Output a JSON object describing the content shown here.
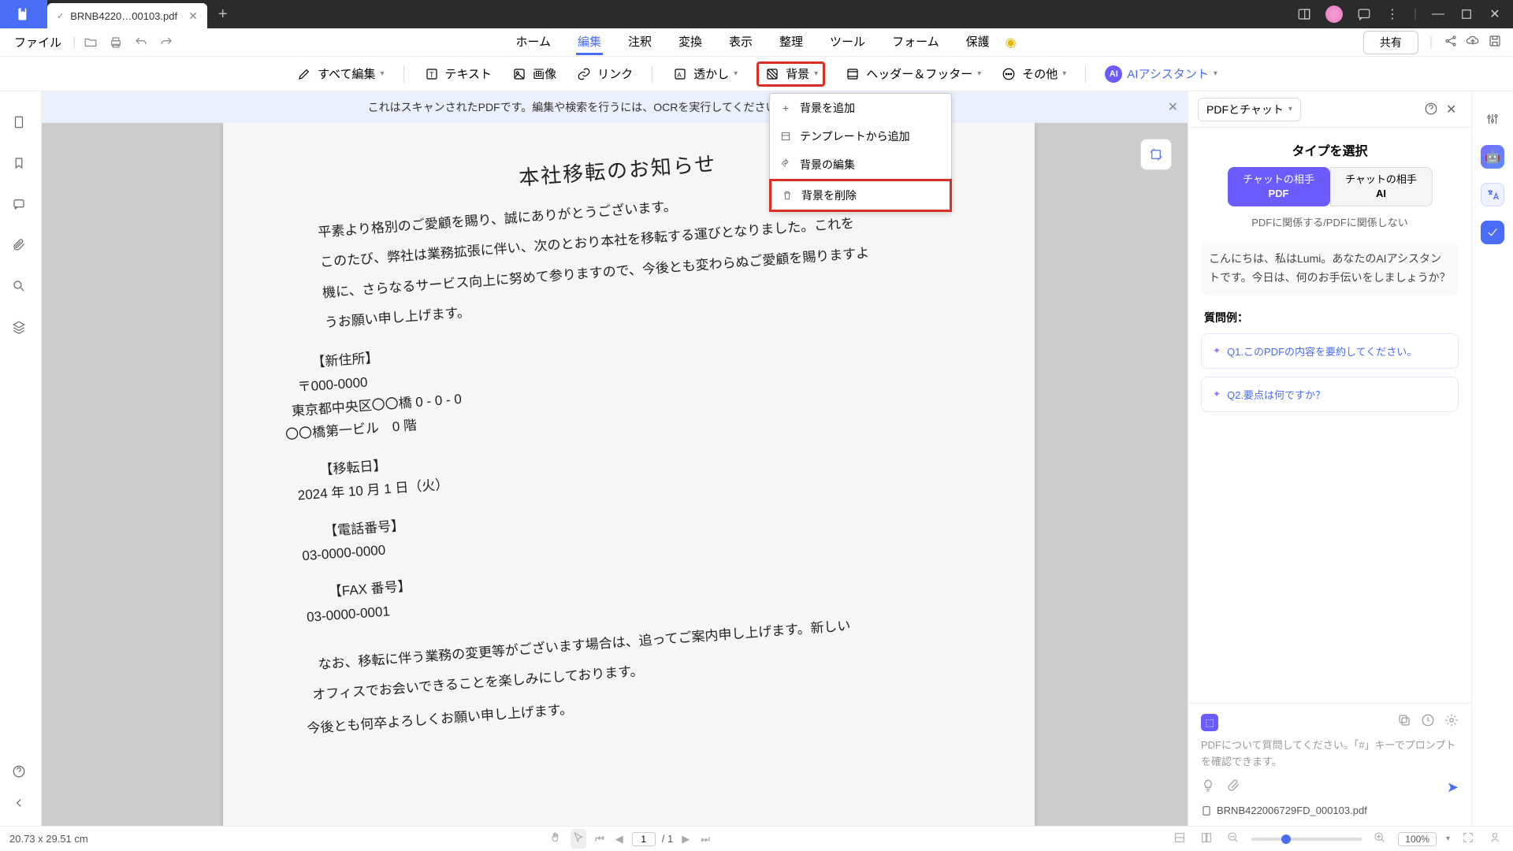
{
  "titlebar": {
    "tab_name": "BRNB4220…00103.pdf"
  },
  "menubar": {
    "file": "ファイル",
    "tabs": [
      "ホーム",
      "編集",
      "注釈",
      "変換",
      "表示",
      "整理",
      "ツール",
      "フォーム",
      "保護"
    ],
    "active_tab_index": 1,
    "share": "共有"
  },
  "toolbar": {
    "edit_all": "すべて編集",
    "text": "テキスト",
    "image": "画像",
    "link": "リンク",
    "watermark": "透かし",
    "background": "背景",
    "header_footer": "ヘッダー＆フッター",
    "other": "その他",
    "ai_assistant": "AIアシスタント"
  },
  "dropdown": {
    "items": [
      "背景を追加",
      "テンプレートから追加",
      "背景の編集",
      "背景を削除"
    ],
    "highlight_index": 3
  },
  "ocr_banner": {
    "text": "これはスキャンされたPDFです。編集や検索を行うには、OCRを実行してください。",
    "button": "OCRを"
  },
  "document": {
    "title": "本社移転のお知らせ",
    "p1": "平素より格別のご愛顧を賜り、誠にありがとうございます。",
    "p2": "このたび、弊社は業務拡張に伴い、次のとおり本社を移転する運びとなりました。これを",
    "p3": "機に、さらなるサービス向上に努めて参りますので、今後とも変わらぬご愛顧を賜りますよ",
    "p4": "うお願い申し上げます。",
    "addr_h": "【新住所】",
    "addr_1": "〒000-0000",
    "addr_2": "東京都中央区〇〇橋 0 - 0 - 0",
    "addr_3": "〇〇橋第一ビル　0 階",
    "date_h": "【移転日】",
    "date_1": "2024 年 10 月 1 日（火）",
    "tel_h": "【電話番号】",
    "tel_1": "03-0000-0000",
    "fax_h": "【FAX 番号】",
    "fax_1": "03-0000-0001",
    "p5": "なお、移転に伴う業務の変更等がございます場合は、追ってご案内申し上げます。新しい",
    "p6": "オフィスでお会いできることを楽しみにしております。",
    "p7": "今後とも何卒よろしくお願い申し上げます。"
  },
  "right_panel": {
    "selector": "PDFとチャット",
    "title": "タイプを選択",
    "tab1_l1": "チャットの相手",
    "tab1_l2": "PDF",
    "tab2_l1": "チャットの相手",
    "tab2_l2": "AI",
    "sub": "PDFに関係する/PDFに関係しない",
    "greeting": "こんにちは、私はLumi。あなたのAIアシスタントです。今日は、何のお手伝いをしましょうか？",
    "q_head": "質問例：",
    "q1": "Q1.このPDFの内容を要約してください。",
    "q2": "Q2.要点は何ですか？",
    "placeholder": "PDFについて質問してください。「#」キーでプロンプトを確認できます。",
    "file": "BRNB422006729FD_000103.pdf"
  },
  "statusbar": {
    "dims": "20.73 x 29.51 cm",
    "page_current": "1",
    "page_total": "/ 1",
    "zoom": "100%"
  }
}
